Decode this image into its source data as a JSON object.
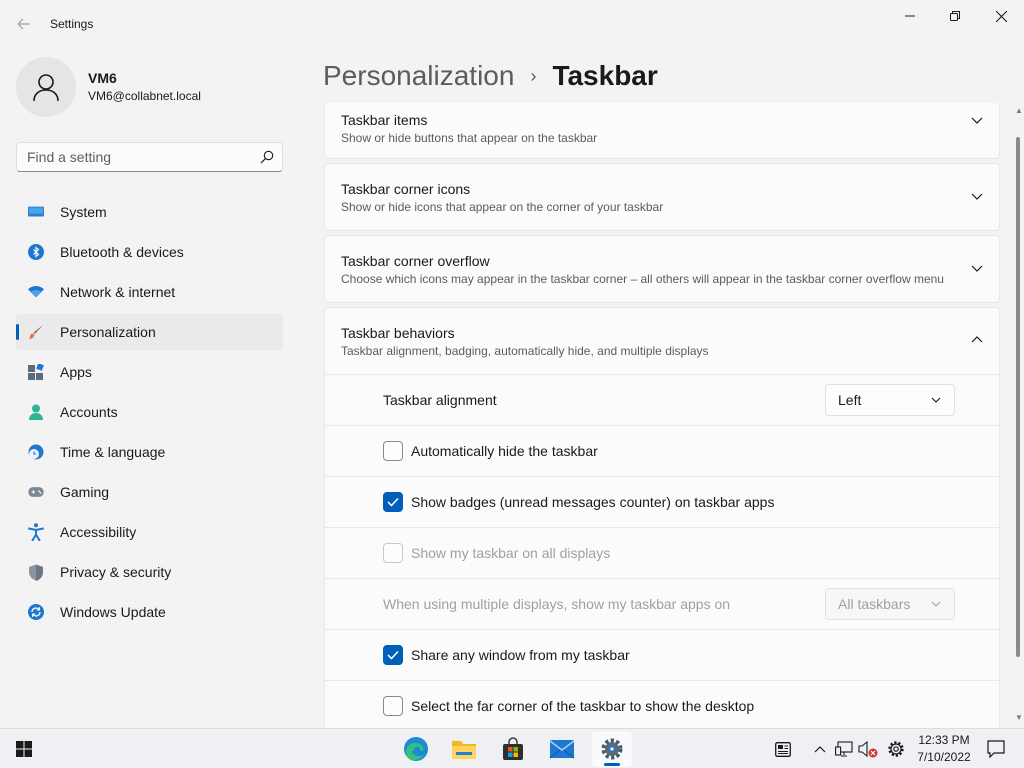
{
  "window": {
    "app_title": "Settings",
    "back_icon": "back-arrow-icon",
    "controls": [
      "minimize-icon",
      "maximize-icon",
      "close-icon"
    ]
  },
  "user": {
    "name": "VM6",
    "email": "VM6@collabnet.local",
    "avatar_icon": "person-icon"
  },
  "search": {
    "placeholder": "Find a setting",
    "icon": "search-icon"
  },
  "sidebar": {
    "items": [
      {
        "label": "System",
        "icon": "monitor-icon",
        "active": false
      },
      {
        "label": "Bluetooth & devices",
        "icon": "bluetooth-icon",
        "active": false
      },
      {
        "label": "Network & internet",
        "icon": "wifi-icon",
        "active": false
      },
      {
        "label": "Personalization",
        "icon": "paintbrush-icon",
        "active": true
      },
      {
        "label": "Apps",
        "icon": "apps-icon",
        "active": false
      },
      {
        "label": "Accounts",
        "icon": "accounts-icon",
        "active": false
      },
      {
        "label": "Time & language",
        "icon": "clock-globe-icon",
        "active": false
      },
      {
        "label": "Gaming",
        "icon": "gamepad-icon",
        "active": false
      },
      {
        "label": "Accessibility",
        "icon": "accessibility-icon",
        "active": false
      },
      {
        "label": "Privacy & security",
        "icon": "shield-icon",
        "active": false
      },
      {
        "label": "Windows Update",
        "icon": "update-icon",
        "active": false
      }
    ]
  },
  "breadcrumb": {
    "parent": "Personalization",
    "separator": "›",
    "current": "Taskbar"
  },
  "sections": [
    {
      "title": "Taskbar items",
      "desc": "Show or hide buttons that appear on the taskbar",
      "expanded": false
    },
    {
      "title": "Taskbar corner icons",
      "desc": "Show or hide icons that appear on the corner of your taskbar",
      "expanded": false
    },
    {
      "title": "Taskbar corner overflow",
      "desc": "Choose which icons may appear in the taskbar corner – all others will appear in the taskbar corner overflow menu",
      "expanded": false
    },
    {
      "title": "Taskbar behaviors",
      "desc": "Taskbar alignment, badging, automatically hide, and multiple displays",
      "expanded": true
    }
  ],
  "behaviors": {
    "alignment": {
      "label": "Taskbar alignment",
      "value": "Left"
    },
    "auto_hide": {
      "label": "Automatically hide the taskbar",
      "checked": false,
      "enabled": true
    },
    "badges": {
      "label": "Show badges (unread messages counter) on taskbar apps",
      "checked": true,
      "enabled": true
    },
    "all_displays": {
      "label": "Show my taskbar on all displays",
      "checked": false,
      "enabled": false
    },
    "multi_display": {
      "label": "When using multiple displays, show my taskbar apps on",
      "value": "All taskbars",
      "enabled": false
    },
    "share_window": {
      "label": "Share any window from my taskbar",
      "checked": true,
      "enabled": true
    },
    "far_corner": {
      "label": "Select the far corner of the taskbar to show the desktop",
      "checked": false,
      "enabled": true
    }
  },
  "taskbar": {
    "apps": [
      "start-icon",
      "edge-icon",
      "file-explorer-icon",
      "store-icon",
      "mail-icon",
      "settings-icon"
    ],
    "active_app": "settings-icon",
    "tray": [
      "news-icon",
      "chevron-up-icon",
      "network-icon",
      "volume-muted-icon",
      "gear-icon",
      "notification-icon"
    ],
    "time": "12:33 PM",
    "date": "7/10/2022"
  },
  "colors": {
    "accent": "#005fb8",
    "background": "#f3f3f3",
    "card": "#fbfbfb"
  }
}
